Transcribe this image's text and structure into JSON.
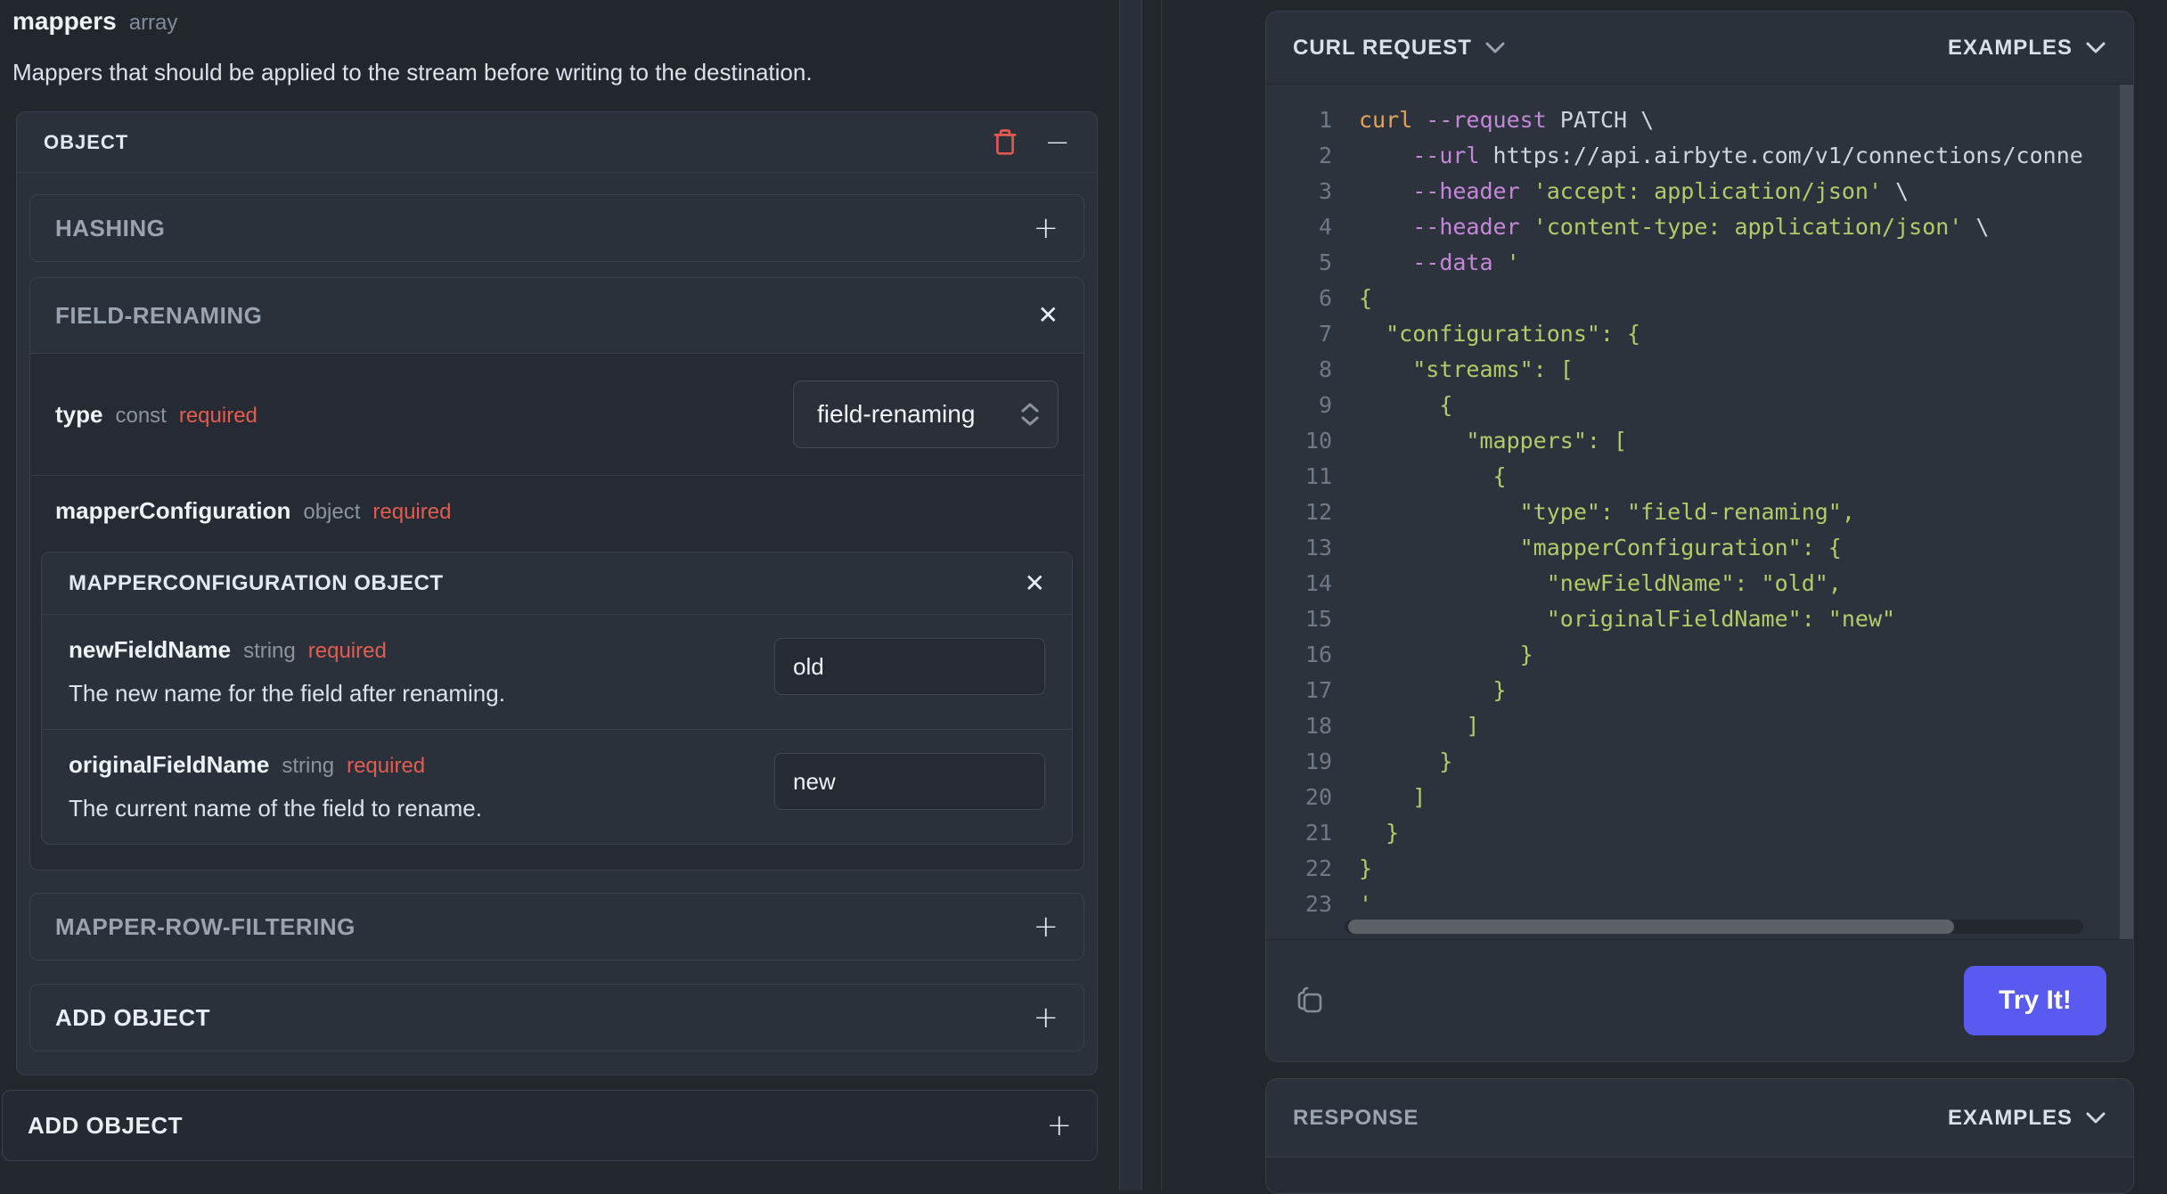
{
  "icons": {
    "plus": "+",
    "minus": "−",
    "close": "✕"
  },
  "colors": {
    "page_bg": "#22272e",
    "panel_bg": "#2b313a",
    "required_red": "#e25d50",
    "trash_red": "#e25a4f",
    "try_button_blue": "#585af0",
    "code_keyword_orange": "#e3a45c",
    "code_flag_purple": "#c586db",
    "code_string_green": "#b3cb68",
    "code_plain": "#cdd5de"
  },
  "field": {
    "name": "mappers",
    "type": "array",
    "description": "Mappers that should be applied to the stream before writing to the destination."
  },
  "object_panel": {
    "title": "OBJECT",
    "hashing": {
      "label": "HASHING"
    },
    "field_renaming": {
      "label": "FIELD-RENAMING",
      "type_row": {
        "name": "type",
        "kind": "const",
        "required": "required",
        "value": "field-renaming"
      },
      "mapper_configuration": {
        "name": "mapperConfiguration",
        "kind": "object",
        "required": "required",
        "panel_title": "MAPPERCONFIGURATION OBJECT",
        "fields": [
          {
            "name": "newFieldName",
            "kind": "string",
            "required": "required",
            "value": "old",
            "description": "The new name for the field after renaming."
          },
          {
            "name": "originalFieldName",
            "kind": "string",
            "required": "required",
            "value": "new",
            "description": "The current name of the field to rename."
          }
        ]
      }
    },
    "mapper_row_filtering": {
      "label": "MAPPER-ROW-FILTERING"
    },
    "add_object": {
      "label": "ADD OBJECT"
    }
  },
  "add_object_outer": {
    "label": "ADD OBJECT"
  },
  "curl_panel": {
    "title": "CURL REQUEST",
    "examples_label": "EXAMPLES",
    "try_button": "Try It!",
    "code": {
      "lines": [
        [
          [
            "k",
            "curl"
          ],
          [
            "p",
            " "
          ],
          [
            "f",
            "--request"
          ],
          [
            "p",
            " PATCH \\"
          ]
        ],
        [
          [
            "p",
            "    "
          ],
          [
            "f",
            "--url"
          ],
          [
            "p",
            " https://api.airbyte.com/v1/connections/conne"
          ]
        ],
        [
          [
            "p",
            "    "
          ],
          [
            "f",
            "--header"
          ],
          [
            "p",
            " "
          ],
          [
            "s",
            "'accept: application/json'"
          ],
          [
            "p",
            " \\"
          ]
        ],
        [
          [
            "p",
            "    "
          ],
          [
            "f",
            "--header"
          ],
          [
            "p",
            " "
          ],
          [
            "s",
            "'content-type: application/json'"
          ],
          [
            "p",
            " \\"
          ]
        ],
        [
          [
            "p",
            "    "
          ],
          [
            "f",
            "--data"
          ],
          [
            "p",
            " "
          ],
          [
            "s",
            "'"
          ]
        ],
        [
          [
            "s",
            "{"
          ]
        ],
        [
          [
            "s",
            "  \"configurations\": {"
          ]
        ],
        [
          [
            "s",
            "    \"streams\": ["
          ]
        ],
        [
          [
            "s",
            "      {"
          ]
        ],
        [
          [
            "s",
            "        \"mappers\": ["
          ]
        ],
        [
          [
            "s",
            "          {"
          ]
        ],
        [
          [
            "s",
            "            \"type\": \"field-renaming\","
          ]
        ],
        [
          [
            "s",
            "            \"mapperConfiguration\": {"
          ]
        ],
        [
          [
            "s",
            "              \"newFieldName\": \"old\","
          ]
        ],
        [
          [
            "s",
            "              \"originalFieldName\": \"new\""
          ]
        ],
        [
          [
            "s",
            "            }"
          ]
        ],
        [
          [
            "s",
            "          }"
          ]
        ],
        [
          [
            "s",
            "        ]"
          ]
        ],
        [
          [
            "s",
            "      }"
          ]
        ],
        [
          [
            "s",
            "    ]"
          ]
        ],
        [
          [
            "s",
            "  }"
          ]
        ],
        [
          [
            "s",
            "}"
          ]
        ],
        [
          [
            "s",
            "'"
          ]
        ]
      ]
    }
  },
  "response_panel": {
    "title": "RESPONSE",
    "examples_label": "EXAMPLES"
  }
}
